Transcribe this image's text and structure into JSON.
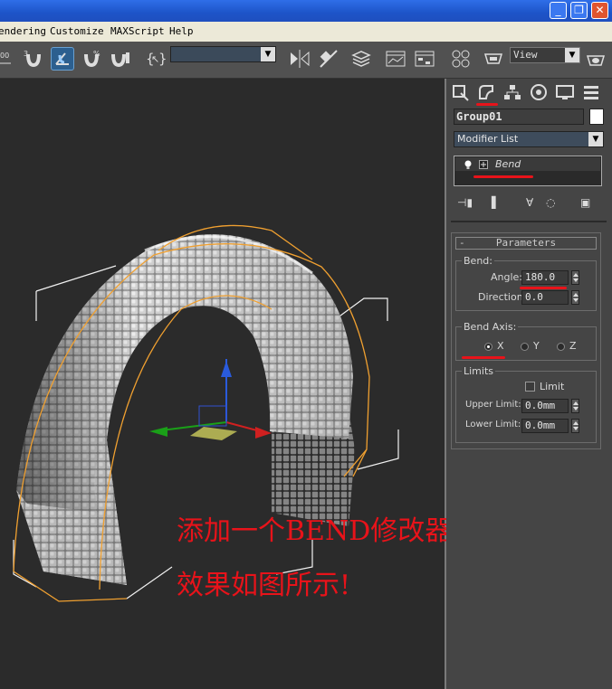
{
  "menubar": {
    "items": [
      "endering",
      "Customize",
      "MAXScript",
      "Help"
    ]
  },
  "toolbar": {
    "selection_set_value": "",
    "view_combo": "View"
  },
  "command_panel": {
    "object_name": "Group01",
    "modifier_list": "Modifier List",
    "stack": [
      "Bend"
    ],
    "parameters": {
      "title": "Parameters",
      "bend_group": "Bend:",
      "angle_label": "Angle:",
      "angle_value": "180.0",
      "direction_label": "Direction:",
      "direction_value": "0.0",
      "bend_axis_group": "Bend Axis:",
      "axes": [
        "X",
        "Y",
        "Z"
      ],
      "selected_axis": "X",
      "limits_group": "Limits",
      "limit_label": "Limit",
      "limit_checked": false,
      "upper_limit_label": "Upper Limit:",
      "upper_limit_value": "0.0mm",
      "lower_limit_label": "Lower Limit:",
      "lower_limit_value": "0.0mm"
    }
  },
  "annotation": {
    "line1": "添加一个BEND修改器,",
    "line2": "效果如图所示!"
  },
  "colors": {
    "annotation": "#e8131a",
    "selection_box": "#f0a030",
    "viewport_bg": "#2b2b2b",
    "panel_bg": "#454545"
  }
}
